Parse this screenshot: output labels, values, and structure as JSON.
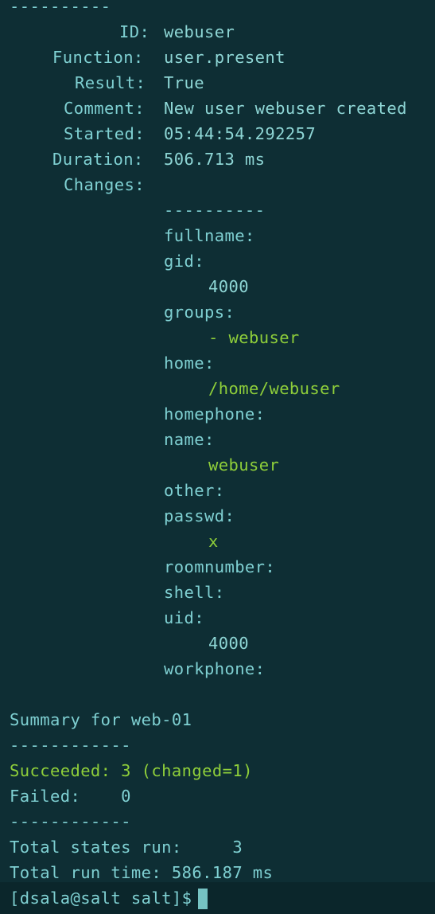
{
  "terminal": {
    "separator_top": "----------",
    "fields": {
      "id_key": "ID:",
      "id_val": "webuser",
      "function_key": "Function:",
      "function_val": "user.present",
      "result_key": "Result:",
      "result_val": "True",
      "comment_key": "Comment:",
      "comment_val": "New user webuser created",
      "started_key": "Started:",
      "started_val": "05:44:54.292257",
      "duration_key": "Duration:",
      "duration_val": "506.713 ms",
      "changes_key": "Changes:"
    },
    "changes": {
      "separator": "----------",
      "fullname_key": "fullname:",
      "gid_key": "gid:",
      "gid_val": "4000",
      "groups_key": "groups:",
      "groups_val": "- webuser",
      "home_key": "home:",
      "home_val": "/home/webuser",
      "homephone_key": "homephone:",
      "name_key": "name:",
      "name_val": "webuser",
      "other_key": "other:",
      "passwd_key": "passwd:",
      "passwd_val": "x",
      "roomnumber_key": "roomnumber:",
      "shell_key": "shell:",
      "uid_key": "uid:",
      "uid_val": "4000",
      "workphone_key": "workphone:"
    },
    "summary": {
      "title": "Summary for web-01",
      "separator1": "------------",
      "succeeded": "Succeeded: 3 (changed=1)",
      "failed": "Failed:    0",
      "separator2": "------------",
      "total_states": "Total states run:     3",
      "total_time": "Total run time: 586.187 ms"
    },
    "prompt": "[dsala@salt salt]$"
  },
  "colors": {
    "background": "#0e2e34",
    "key": "#7fd0d2",
    "green": "#8fcf3a",
    "value": "#8ed6d5"
  }
}
